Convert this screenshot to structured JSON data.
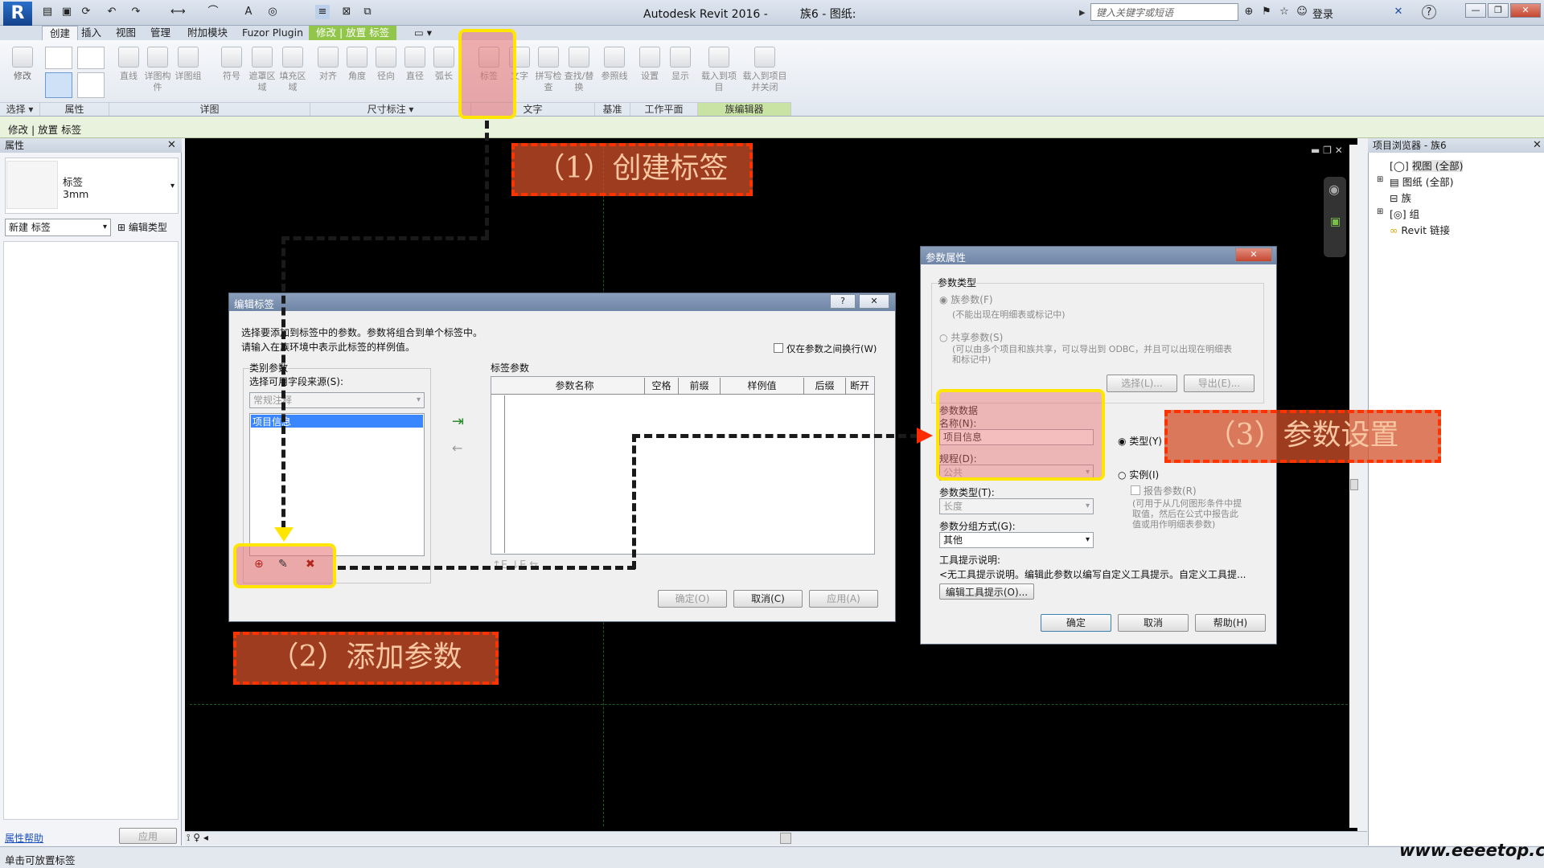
{
  "app": {
    "title": "Autodesk Revit 2016 -",
    "doc": "族6 - 图纸:",
    "search_placeholder": "键入关键字或短语",
    "login": "登录"
  },
  "tabs": [
    "创建",
    "插入",
    "视图",
    "管理",
    "附加模块",
    "Fuzor Plugin",
    "修改 | 放置 标签"
  ],
  "ribbon": {
    "buttons": [
      "修改",
      "直线",
      "详图构件",
      "详图组",
      "符号",
      "遮罩区域",
      "填充区域",
      "对齐",
      "角度",
      "径向",
      "直径",
      "弧长",
      "标签",
      "文字",
      "拼写检查",
      "查找/替换",
      "参照线",
      "设置",
      "显示",
      "载入到项目",
      "载入到项目并关闭"
    ],
    "panels": [
      "选择 ▾",
      "属性",
      "详图",
      "尺寸标注 ▾",
      "文字",
      "基准",
      "工作平面",
      "族编辑器"
    ]
  },
  "options_bar": "修改 | 放置 标签",
  "properties": {
    "header": "属性",
    "type_name": "标签",
    "type_size": "3mm",
    "type_selector": "新建 标签",
    "edit_type": "编辑类型",
    "help_link": "属性帮助",
    "apply": "应用"
  },
  "status": "单击可放置标签",
  "browser": {
    "header": "项目浏览器 - 族6",
    "items": [
      "视图 (全部)",
      "图纸 (全部)",
      "族",
      "组",
      "Revit 链接"
    ]
  },
  "edit_label": {
    "title": "编辑标签",
    "intro1": "选择要添加到标签中的参数。参数将组合到单个标签中。",
    "intro2": "请输入在族环境中表示此标签的样例值。",
    "wrap_checkbox": "仅在参数之间换行(W)",
    "category_group": "类别参数",
    "source_label": "选择可用字段来源(S):",
    "source_value": "常规注释",
    "list_selected": "项目信息",
    "label_params": "标签参数",
    "columns": [
      "参数名称",
      "空格",
      "前缀",
      "样例值",
      "后缀",
      "断开"
    ],
    "ok": "确定(O)",
    "cancel": "取消(C)",
    "apply": "应用(A)"
  },
  "param_props": {
    "title": "参数属性",
    "param_type": "参数类型",
    "family_param": "族参数(F)",
    "family_note": "(不能出现在明细表或标记中)",
    "shared_param": "共享参数(S)",
    "shared_note1": "(可以由多个项目和族共享，可以导出到 ODBC，并且可以出现在明细表",
    "shared_note2": "和标记中)",
    "select_btn": "选择(L)...",
    "export_btn": "导出(E)...",
    "param_data": "参数数据",
    "name_label": "名称(N):",
    "name_value": "项目信息",
    "discipline_label": "规程(D):",
    "discipline_value": "公共",
    "type_radio": "类型(Y)",
    "instance_radio": "实例(I)",
    "ptype_label": "参数类型(T):",
    "ptype_value": "长度",
    "report_checkbox": "报告参数(R)",
    "report_note1": "(可用于从几何图形条件中提",
    "report_note2": "取值，然后在公式中报告此",
    "report_note3": "值或用作明细表参数)",
    "group_label": "参数分组方式(G):",
    "group_value": "其他",
    "tooltip_label": "工具提示说明:",
    "tooltip_value": "<无工具提示说明。编辑此参数以编写自定义工具提示。自定义工具提...",
    "edit_tooltip": "编辑工具提示(O)...",
    "ok": "确定",
    "cancel": "取消",
    "help": "帮助(H)"
  },
  "callouts": [
    "（1）创建标签",
    "（2）添加参数",
    "（3）参数设置"
  ],
  "watermark": "www.eeeetop.com"
}
